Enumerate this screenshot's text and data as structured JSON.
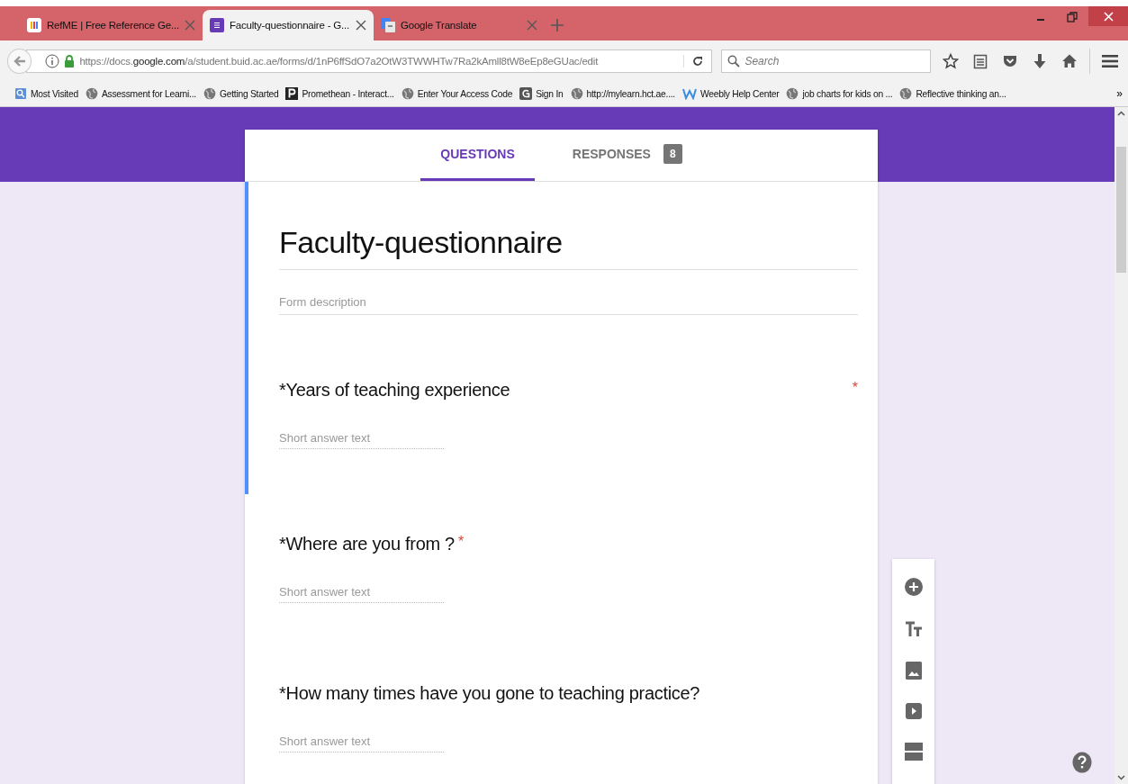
{
  "browser_tabs": [
    {
      "title": "RefME | Free Reference Ge...",
      "kind": "bars",
      "selected": false
    },
    {
      "title": "Faculty-questionnaire - G...",
      "kind": "form",
      "selected": true
    },
    {
      "title": "Google Translate",
      "kind": "translate",
      "selected": false
    }
  ],
  "address_bar": {
    "url_start": "https://docs.",
    "url_domain": "google.com",
    "url_rest": "/a/student.buid.ac.ae/forms/d/1nP6ffSdO7a2OtW3TWWHTw7Ra2kAmll8tW8eEp8eGUac/edit"
  },
  "search": {
    "placeholder": "Search"
  },
  "bookmarks": [
    {
      "label": "Most Visited",
      "kind": "folder"
    },
    {
      "label": "Assessment for Learni...",
      "kind": "globe"
    },
    {
      "label": "Getting Started",
      "kind": "globe"
    },
    {
      "label": "Promethean - Interact...",
      "kind": "p"
    },
    {
      "label": "Enter Your Access Code",
      "kind": "globe"
    },
    {
      "label": "Sign In",
      "kind": "g"
    },
    {
      "label": "http://mylearn.hct.ae....",
      "kind": "globe"
    },
    {
      "label": "Weebly Help Center",
      "kind": "w"
    },
    {
      "label": "job charts for kids on ...",
      "kind": "globe"
    },
    {
      "label": "Reflective thinking an...",
      "kind": "globe"
    }
  ],
  "bookmarks_overflow": "»",
  "form_tabs": [
    {
      "label": "QUESTIONS",
      "selected": true
    },
    {
      "label": "RESPONSES",
      "selected": false,
      "badge": "8"
    }
  ],
  "form": {
    "title": "Faculty-questionnaire",
    "description_placeholder": "Form description",
    "focused": true
  },
  "questions": [
    {
      "text": "*Years of teaching experience",
      "required_mark": "*",
      "kind": "end",
      "answer_placeholder": "Short answer text",
      "focused": true
    },
    {
      "text": "*Where are you from ?",
      "required_mark": "*",
      "kind": "inline",
      "answer_placeholder": "Short answer text",
      "focused": false
    },
    {
      "text": "*How many times have you gone to teaching practice?",
      "answer_placeholder": "Short answer text",
      "focused": false
    }
  ],
  "tools": [
    {
      "kind": "add"
    },
    {
      "kind": "title"
    },
    {
      "kind": "image"
    },
    {
      "kind": "video"
    },
    {
      "kind": "section"
    }
  ]
}
